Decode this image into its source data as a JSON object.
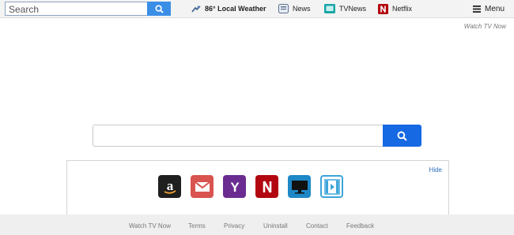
{
  "toolbar": {
    "search_placeholder": "Search",
    "weather_label": "86° Local Weather",
    "news_label": "News",
    "tvnews_label": "TVNews",
    "netflix_label": "Netflix",
    "menu_label": "Menu"
  },
  "header": {
    "watch_link": "Watch TV Now"
  },
  "main_search": {
    "placeholder": ""
  },
  "tiles_panel": {
    "hide_label": "Hide",
    "tiles": [
      {
        "name": "amazon-tile",
        "icon": "amazon-icon",
        "color": "#1f1f1f"
      },
      {
        "name": "gmail-tile",
        "icon": "mail-icon",
        "color": "#d9534f"
      },
      {
        "name": "yahoo-tile",
        "icon": "yahoo-icon",
        "color": "#6a2c91"
      },
      {
        "name": "netflix-tile",
        "icon": "netflix-icon",
        "color": "#b20710"
      },
      {
        "name": "tv-tile",
        "icon": "tv-icon",
        "color": "#1e88c7"
      },
      {
        "name": "video-tile",
        "icon": "film-icon",
        "color": "#3da5d9"
      }
    ]
  },
  "footer": {
    "links": [
      "Watch TV Now",
      "Terms",
      "Privacy",
      "Uninstall",
      "Contact",
      "Feedback"
    ]
  },
  "colors": {
    "accent_blue": "#1668e3",
    "toolbar_btn": "#3a8ee6",
    "link_blue": "#2a6ebb"
  }
}
